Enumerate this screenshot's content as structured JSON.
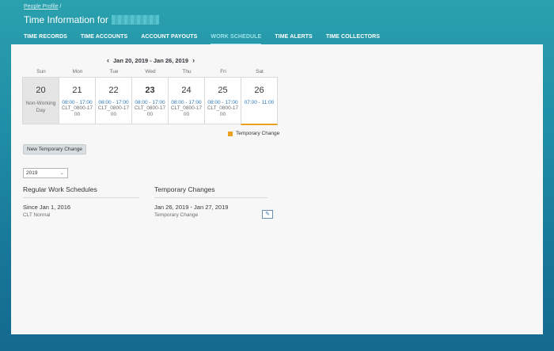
{
  "header": {
    "breadcrumb_link": "People Profile",
    "breadcrumb_sep": "/",
    "title_prefix": "Time Information for"
  },
  "tabs": [
    {
      "label": "TIME RECORDS"
    },
    {
      "label": "TIME ACCOUNTS"
    },
    {
      "label": "ACCOUNT PAYOUTS"
    },
    {
      "label": "WORK SCHEDULE",
      "active": true
    },
    {
      "label": "TIME ALERTS"
    },
    {
      "label": "TIME COLLECTORS"
    }
  ],
  "calendar": {
    "range": "Jan 20, 2019 - Jan 26, 2019",
    "days": [
      {
        "name": "Sun",
        "num": "20",
        "note": "Non-Working Day"
      },
      {
        "name": "Mon",
        "num": "21",
        "time": "08:00 - 17:00",
        "code": "CLT_0800-1700"
      },
      {
        "name": "Tue",
        "num": "22",
        "time": "08:00 - 17:00",
        "code": "CLT_0800-1700"
      },
      {
        "name": "Wed",
        "num": "23",
        "time": "08:00 - 17:00",
        "code": "CLT_0800-1700"
      },
      {
        "name": "Thu",
        "num": "24",
        "time": "08:00 - 17:00",
        "code": "CLT_0800-1700"
      },
      {
        "name": "Fri",
        "num": "25",
        "time": "08:00 - 17:00",
        "code": "CLT_0800-1700"
      },
      {
        "name": "Sat",
        "num": "26",
        "time": "07:00 - 11:00"
      }
    ],
    "legend_label": "Temporary Change",
    "legend_color": "#e9a11f"
  },
  "new_temp_button": "New Temporary Change",
  "year_select": {
    "value": "2019"
  },
  "regular": {
    "title": "Regular Work Schedules",
    "since": "Since Jan 1, 2016",
    "name": "CLT Normal"
  },
  "temporary": {
    "title": "Temporary Changes",
    "range": "Jan 26, 2019 - Jan 27, 2019",
    "name": "Temporary Change"
  },
  "icons": {
    "prev": "chevron-left-icon",
    "next": "chevron-right-icon",
    "edit": "pencil-icon",
    "dropdown": "chevron-down-icon"
  }
}
